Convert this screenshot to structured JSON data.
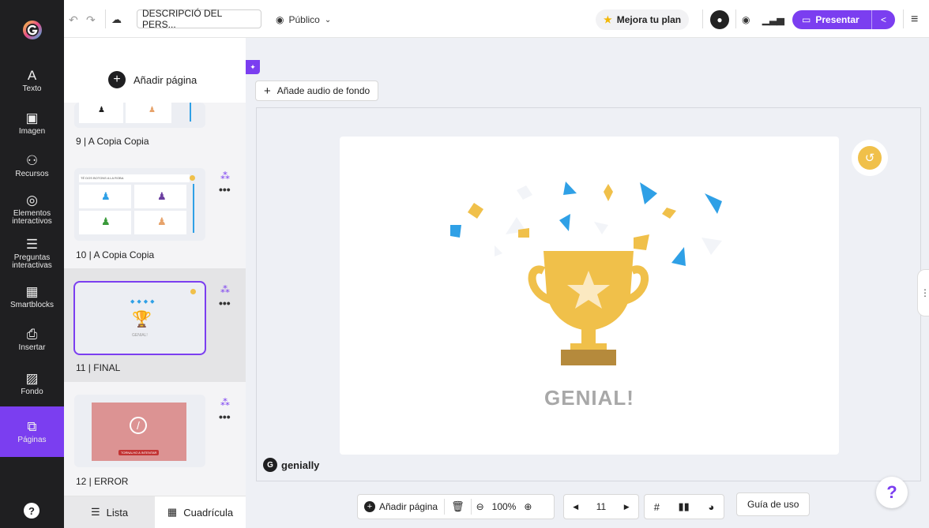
{
  "rail": {
    "items": [
      {
        "label": "Texto",
        "icon": "A",
        "name": "text"
      },
      {
        "label": "Imagen",
        "icon": "▣",
        "name": "image"
      },
      {
        "label": "Recursos",
        "icon": "⚇",
        "name": "resources"
      },
      {
        "label": "Elementos\ninteractivos",
        "icon": "◎",
        "name": "interactive-elements"
      },
      {
        "label": "Preguntas\ninteractivas",
        "icon": "☰",
        "name": "interactive-questions"
      },
      {
        "label": "Smartblocks",
        "icon": "▦",
        "name": "smartblocks"
      },
      {
        "label": "Insertar",
        "icon": "⎙",
        "name": "insert"
      },
      {
        "label": "Fondo",
        "icon": "▨",
        "name": "background"
      },
      {
        "label": "Páginas",
        "icon": "⧉",
        "name": "pages"
      }
    ],
    "help_icon": "?"
  },
  "topbar": {
    "doc_title": "DESCRIPCIÓ DEL PERS...",
    "visibility": "Público",
    "upgrade": "Mejora tu plan",
    "present": "Presentar"
  },
  "panel": {
    "add_page": "Añadir página",
    "pages": [
      {
        "label": "9 | A Copia Copia"
      },
      {
        "label": "10 | A Copia Copia",
        "thumb_title": "TÉ DOS BOTONS A LA ROBA"
      },
      {
        "label": "11 | FINAL",
        "thumb_text": "GENIAL!"
      },
      {
        "label": "12 | ERROR",
        "thumb_text": "TORNA-HO A INTENTAR"
      }
    ],
    "footer": {
      "list": "Lista",
      "grid": "Cuadrícula"
    }
  },
  "stage": {
    "audio": "Añade audio de fondo",
    "slide_text": "GENIAL!",
    "brand": "genially",
    "guide": "Guía de uso",
    "toolbar": {
      "add_page": "Añadir página",
      "zoom": "100%",
      "page_number": "11"
    }
  },
  "colors": {
    "accent": "#7b3ef0",
    "gold": "#f0c04a",
    "blue": "#2fa0e6"
  }
}
